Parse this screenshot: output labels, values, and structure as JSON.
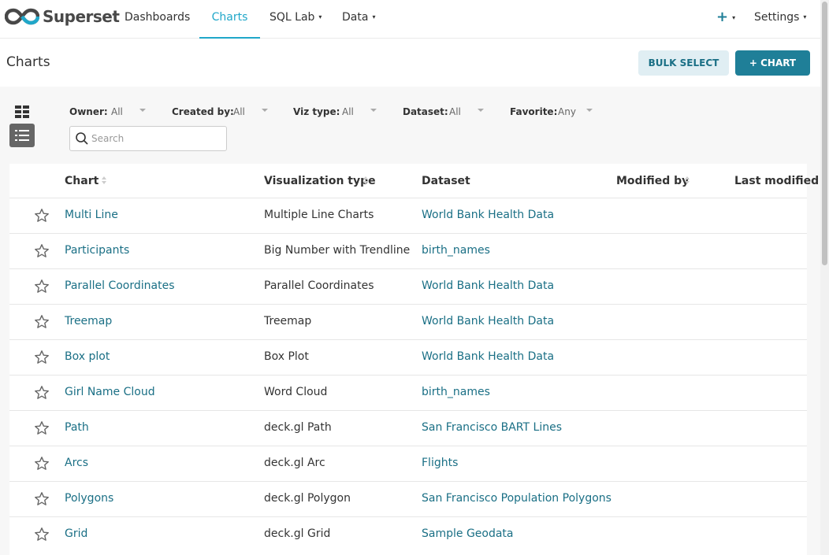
{
  "navbar": {
    "brand": "Superset",
    "items": [
      {
        "label": "Dashboards"
      },
      {
        "label": "Charts"
      },
      {
        "label": "SQL Lab"
      },
      {
        "label": "Data"
      }
    ],
    "plus_glyph": "+",
    "settings_label": "Settings",
    "caret_glyph": "▾"
  },
  "page": {
    "title": "Charts",
    "bulk_select_label": "BULK SELECT",
    "new_chart_label": "+ CHART"
  },
  "filters": [
    {
      "label": "Owner:",
      "value": "All"
    },
    {
      "label": "Created by:",
      "value": "All"
    },
    {
      "label": "Viz type:",
      "value": "All"
    },
    {
      "label": "Dataset:",
      "value": "All"
    },
    {
      "label": "Favorite:",
      "value": "Any"
    }
  ],
  "search": {
    "placeholder": "Search",
    "value": ""
  },
  "table": {
    "columns": [
      "Chart",
      "Visualization type",
      "Dataset",
      "Modified by",
      "Last modified"
    ],
    "rows": [
      {
        "chart": "Multi Line",
        "viz": "Multiple Line Charts",
        "dataset": "World Bank Health Data"
      },
      {
        "chart": "Participants",
        "viz": "Big Number with Trendline",
        "dataset": "birth_names"
      },
      {
        "chart": "Parallel Coordinates",
        "viz": "Parallel Coordinates",
        "dataset": "World Bank Health Data"
      },
      {
        "chart": "Treemap",
        "viz": "Treemap",
        "dataset": "World Bank Health Data"
      },
      {
        "chart": "Box plot",
        "viz": "Box Plot",
        "dataset": "World Bank Health Data"
      },
      {
        "chart": "Girl Name Cloud",
        "viz": "Word Cloud",
        "dataset": "birth_names"
      },
      {
        "chart": "Path",
        "viz": "deck.gl Path",
        "dataset": "San Francisco BART Lines"
      },
      {
        "chart": "Arcs",
        "viz": "deck.gl Arc",
        "dataset": "Flights"
      },
      {
        "chart": "Polygons",
        "viz": "deck.gl Polygon",
        "dataset": "San Francisco Population Polygons"
      },
      {
        "chart": "Grid",
        "viz": "deck.gl Grid",
        "dataset": "Sample Geodata"
      }
    ]
  },
  "colors": {
    "accent": "#20a7c9",
    "primary_button": "#1f7f98",
    "link": "#1a6f85",
    "secondary_button_bg": "#e0eef3"
  },
  "icons": {
    "brand": "superset-logo-icon",
    "card_view": "grid-view-icon",
    "list_view": "list-view-icon",
    "search": "search-icon",
    "favorite": "star-outline-icon",
    "sort": "sort-icon"
  }
}
